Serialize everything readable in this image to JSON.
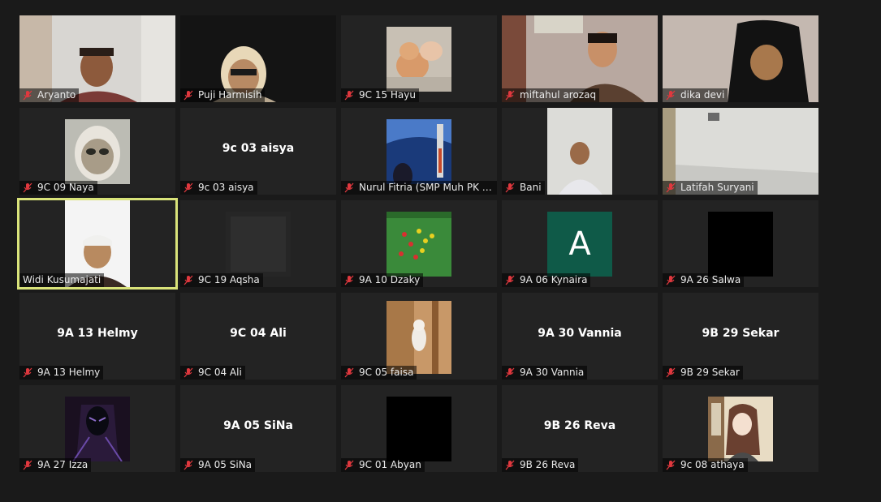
{
  "participants": [
    {
      "name": "Aryanto",
      "center": ""
    },
    {
      "name": "Puji Harmisih",
      "center": ""
    },
    {
      "name": "9C 15 Hayu",
      "center": ""
    },
    {
      "name": "miftahul arozaq",
      "center": ""
    },
    {
      "name": "dika devi",
      "center": ""
    },
    {
      "name": "9C 09 Naya",
      "center": ""
    },
    {
      "name": "9c 03 aisya",
      "center": "9c 03 aisya"
    },
    {
      "name": "Nurul Fitria (SMP Muh PK s...",
      "center": ""
    },
    {
      "name": "Bani",
      "center": ""
    },
    {
      "name": "Latifah Suryani",
      "center": ""
    },
    {
      "name": "Widi Kusumajati",
      "center": ""
    },
    {
      "name": "9C 19 Aqsha",
      "center": ""
    },
    {
      "name": "9A 10 Dzaky",
      "center": ""
    },
    {
      "name": "9A 06 Kynaira",
      "center": "",
      "avatar_letter": "A"
    },
    {
      "name": "9A 26 Salwa",
      "center": ""
    },
    {
      "name": "9A 13 Helmy",
      "center": "9A 13 Helmy"
    },
    {
      "name": "9C 04 Ali",
      "center": "9C 04 Ali"
    },
    {
      "name": "9C 05 faisa",
      "center": ""
    },
    {
      "name": "9A 30 Vannia",
      "center": "9A 30 Vannia"
    },
    {
      "name": "9B 29 Sekar",
      "center": "9B 29 Sekar"
    },
    {
      "name": "9A 27 Izza",
      "center": ""
    },
    {
      "name": "9A 05 SiNa",
      "center": "9A 05 SiNa"
    },
    {
      "name": "9C 01 Abyan",
      "center": ""
    },
    {
      "name": "9B 26 Reva",
      "center": "9B 26 Reva"
    },
    {
      "name": "9c 08 athaya",
      "center": ""
    }
  ],
  "colors": {
    "background": "#1a1a1a",
    "tile": "#232323",
    "active_speaker_border": "#d9e37a",
    "muted_icon": "#e0383e",
    "avatar_bg": "#0f5a48"
  },
  "icons": {
    "muted": "muted-microphone-icon"
  }
}
